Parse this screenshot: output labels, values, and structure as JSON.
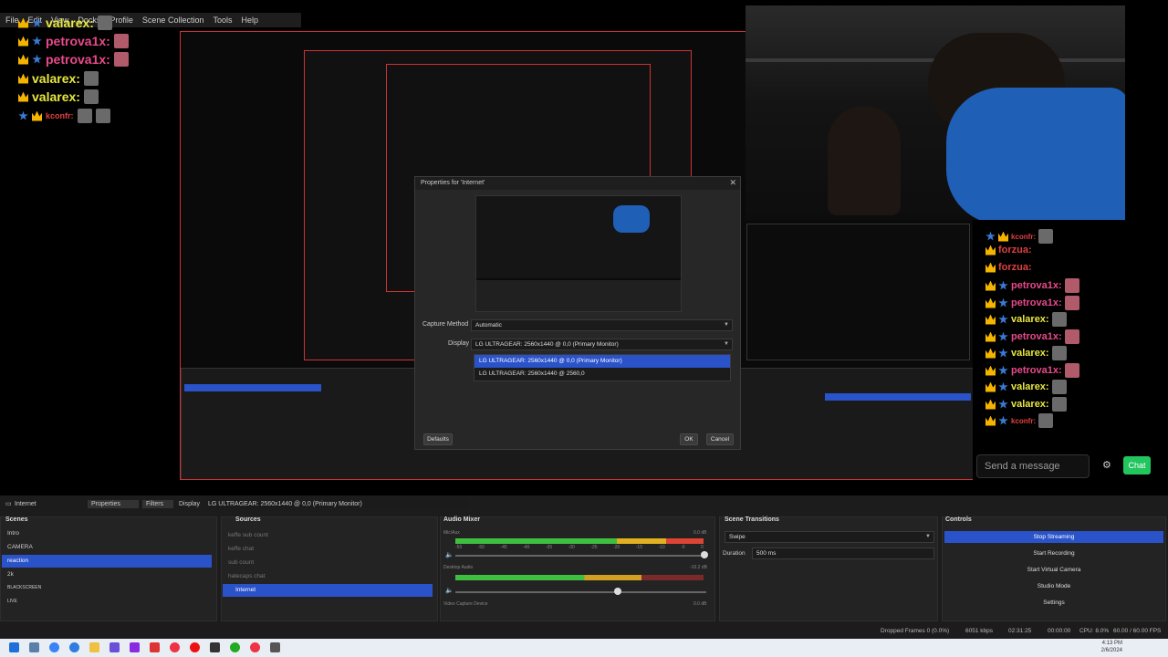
{
  "menubar": {
    "items": [
      "File",
      "Edit",
      "View",
      "Docks",
      "Profile",
      "Scene Collection",
      "Tools",
      "Help"
    ]
  },
  "chat_overlay": [
    {
      "user": "petrova1x:",
      "color": "#e84a8a",
      "badge": "crown"
    },
    {
      "user": "valarex:",
      "color": "#e8e840",
      "badge": "star"
    },
    {
      "user": "petrova1x:",
      "color": "#e84a8a",
      "badge": "crown"
    },
    {
      "user": "petrova1x:",
      "color": "#e84a8a",
      "badge": "crown"
    },
    {
      "user": "valarex:",
      "color": "#e8e840",
      "badge": "crown"
    },
    {
      "user": "valarex:",
      "color": "#e8e840",
      "badge": "crown"
    },
    {
      "user": "kconfr:",
      "color": "#e04040",
      "badge": "star"
    }
  ],
  "right_chat": {
    "messages": [
      {
        "user": "kconfr:",
        "color": "#e04040"
      },
      {
        "user": "forzua:",
        "color": "#e04040"
      },
      {
        "user": "forzua:",
        "color": "#e04040"
      },
      {
        "user": "petrova1x:",
        "color": "#e84a8a"
      },
      {
        "user": "petrova1x:",
        "color": "#e84a8a"
      },
      {
        "user": "valarex:",
        "color": "#e8e840"
      },
      {
        "user": "petrova1x:",
        "color": "#e84a8a"
      },
      {
        "user": "valarex:",
        "color": "#e8e840"
      },
      {
        "user": "petrova1x:",
        "color": "#e84a8a"
      },
      {
        "user": "valarex:",
        "color": "#e8e840"
      },
      {
        "user": "valarex:",
        "color": "#e8e840"
      },
      {
        "user": "kconfr:",
        "color": "#e04040"
      }
    ],
    "input_placeholder": "Send a message",
    "send_label": "Chat"
  },
  "dialog": {
    "title": "Properties for 'Internet'",
    "capture_method_label": "Capture Method",
    "capture_method_value": "Automatic",
    "display_label": "Display",
    "display_value": "LG ULTRAGEAR: 2560x1440 @ 0,0 (Primary Monitor)",
    "dropdown_options": [
      "LG ULTRAGEAR: 2560x1440 @ 0,0 (Primary Monitor)",
      "LG ULTRAGEAR: 2560x1440 @ 2560,0"
    ],
    "defaults_label": "Defaults",
    "ok_label": "OK",
    "cancel_label": "Cancel"
  },
  "toolbar": {
    "source_name": "Internet",
    "properties_label": "Properties",
    "filters_label": "Filters",
    "display_label": "Display",
    "display_value": "LG ULTRAGEAR: 2560x1440 @ 0,0 (Primary Monitor)"
  },
  "scenes": {
    "title": "Scenes",
    "items": [
      "Intro",
      "CAMERA",
      "reaction",
      "2k",
      "BLACKSCREEN",
      "LIVE"
    ],
    "selected": 2
  },
  "sources": {
    "title": "Sources",
    "items": [
      "keffe sub count",
      "keffe chat",
      "sub count",
      "hatecaps chat",
      "Internet"
    ],
    "selected": 4
  },
  "audio_mixer": {
    "title": "Audio Mixer",
    "channels": [
      {
        "name": "Mic/Aux",
        "db": "0.0 dB",
        "level": 0.85
      },
      {
        "name": "Desktop Audio",
        "db": "-10.2 dB",
        "level": 0.7
      },
      {
        "name": "Video Capture Device",
        "db": "0.0 dB",
        "level": 0.0
      }
    ],
    "ticks": [
      "-60",
      "-55",
      "-50",
      "-45",
      "-40",
      "-35",
      "-30",
      "-25",
      "-20",
      "-15",
      "-10",
      "-5",
      "0"
    ]
  },
  "transitions": {
    "title": "Scene Transitions",
    "type": "Swipe",
    "duration_label": "Duration",
    "duration_value": "500 ms"
  },
  "controls": {
    "title": "Controls",
    "buttons": [
      "Stop Streaming",
      "Start Recording",
      "Start Virtual Camera",
      "Studio Mode",
      "Settings"
    ]
  },
  "statusbar": {
    "dropped": "Dropped Frames 0 (0.0%)",
    "bitrate": "6051 kbps",
    "live_time": "02:31:25",
    "rec_time": "00:00:00",
    "cpu": "CPU: 8.0%",
    "fps": "60.00 / 60.00 FPS"
  },
  "clock": {
    "time": "4:13 PM",
    "date": "2/6/2024"
  },
  "colors": {
    "accent": "#2a52c9",
    "chat_send": "#22c55e",
    "preview_border": "#cc3333"
  }
}
